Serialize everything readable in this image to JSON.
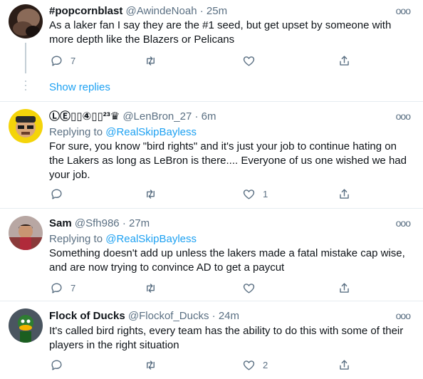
{
  "tweets": [
    {
      "name": "#popcornblast",
      "handle": "@AwindeNoah",
      "sep": "·",
      "time": "25m",
      "replying_prefix": "",
      "replying_to": "",
      "text": "As a laker fan I say they are the #1 seed, but get upset by someone with more depth like the Blazers or Pelicans",
      "reply_count": "7",
      "like_count": ""
    },
    {
      "name": "ⓁⒺ▯▯④▯▯²³♛",
      "handle": "@LenBron_27",
      "sep": "·",
      "time": "6m",
      "replying_prefix": "Replying to",
      "replying_to": "@RealSkipBayless",
      "text": "For sure, you know \"bird rights\" and it's just your job to continue hating on the Lakers as long as LeBron is there.... Everyone of us one wished we had your job.",
      "reply_count": "",
      "like_count": "1"
    },
    {
      "name": "Sam",
      "handle": "@Sfh986",
      "sep": "·",
      "time": "27m",
      "replying_prefix": "Replying to",
      "replying_to": "@RealSkipBayless",
      "text": "Something doesn't add up unless the lakers made a fatal mistake cap wise, and are now trying to convince AD to get a paycut",
      "reply_count": "7",
      "like_count": ""
    },
    {
      "name": "Flock of Ducks",
      "handle": "@Flockof_Ducks",
      "sep": "·",
      "time": "24m",
      "replying_prefix": "",
      "replying_to": "",
      "text": "It's called bird rights, every team has the ability to do this with some of their players in the right situation",
      "reply_count": "",
      "like_count": "2"
    }
  ],
  "show_replies": "Show replies",
  "more_glyph": "ooo",
  "icons": [
    "reply-icon",
    "retweet-icon",
    "like-icon",
    "share-icon",
    "more-icon"
  ],
  "colors": {
    "link": "#1da1f2",
    "secondary": "#5b7083",
    "text": "#0f1419",
    "border": "#e6ecf0"
  }
}
